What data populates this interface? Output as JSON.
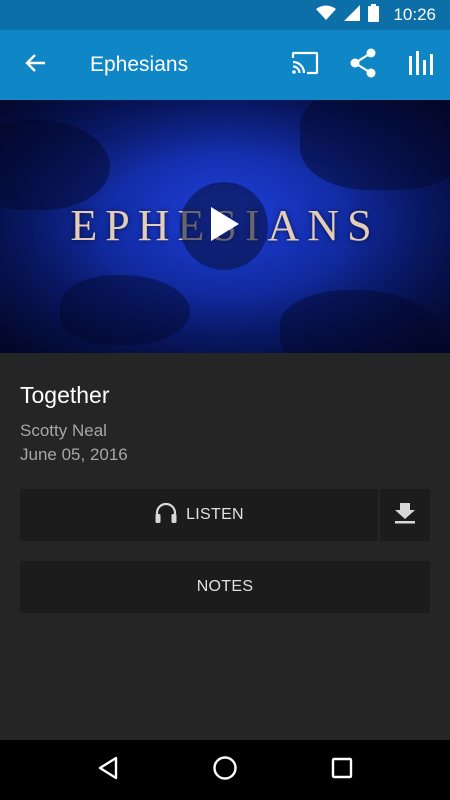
{
  "status_bar": {
    "time": "10:26",
    "icons": [
      "wifi-icon",
      "signal-icon",
      "battery-icon"
    ]
  },
  "app_bar": {
    "title": "Ephesians",
    "icons": [
      "back-arrow-icon",
      "cast-icon",
      "share-icon",
      "equalizer-icon"
    ]
  },
  "hero": {
    "series_title": "EPHESIANS",
    "play_icon": "play-icon"
  },
  "sermon": {
    "title": "Together",
    "speaker": "Scotty Neal",
    "date": "June 05, 2016"
  },
  "actions": {
    "listen_label": "LISTEN",
    "listen_icon": "headphones-icon",
    "download_icon": "download-icon",
    "notes_label": "NOTES"
  },
  "nav_bar": {
    "icons": [
      "back-triangle-icon",
      "home-circle-icon",
      "recents-square-icon"
    ]
  },
  "colors": {
    "status_bar": "#0c6fa8",
    "app_bar": "#0f86c5",
    "background": "#252525",
    "button": "#1c1c1c"
  }
}
